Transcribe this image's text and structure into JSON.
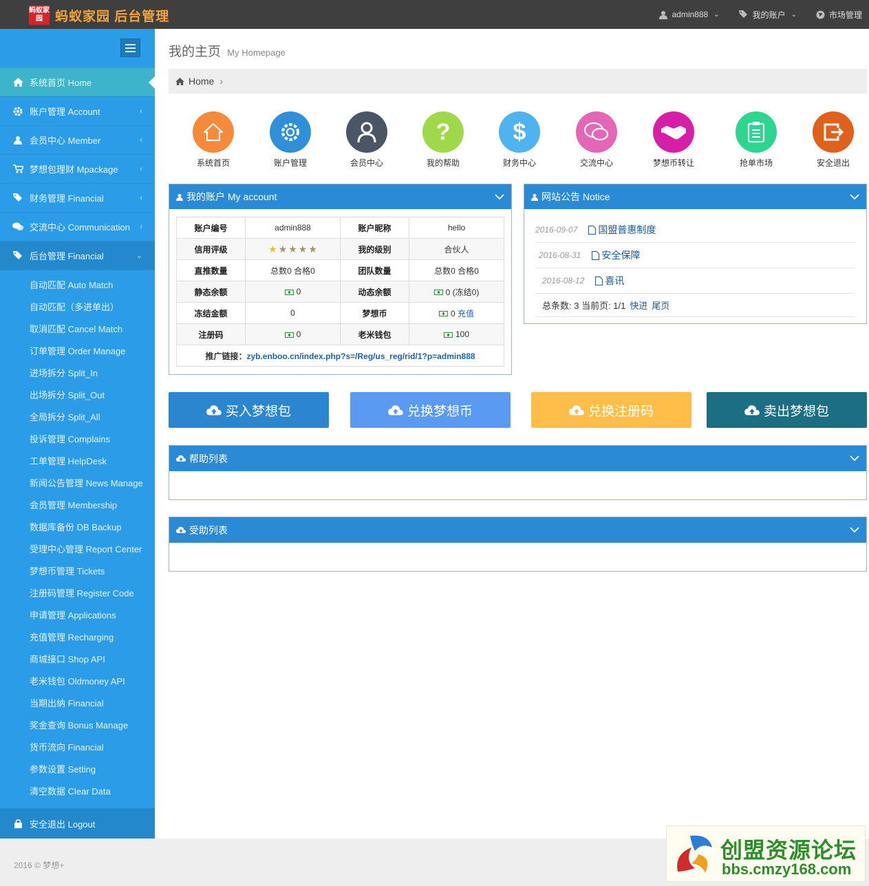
{
  "topbar": {
    "logo_badge": "蚂蚁家园",
    "logo_text": "蚂蚁家园 后台管理",
    "user": "admin888",
    "my_account": "我的账户",
    "market": "市场管理"
  },
  "sidebar": {
    "main_items": [
      {
        "label": "系统首页 Home",
        "icon": "home-icon"
      },
      {
        "label": "账户管理 Account",
        "icon": "gear-icon"
      },
      {
        "label": "会员中心 Member",
        "icon": "user-icon"
      },
      {
        "label": "梦想包理财 Mpackage",
        "icon": "cart-icon"
      },
      {
        "label": "财务管理 Financial",
        "icon": "tags-icon"
      },
      {
        "label": "交流中心 Communication",
        "icon": "comments-icon"
      },
      {
        "label": "后台管理 Financial",
        "icon": "tags-icon"
      }
    ],
    "sub_items": [
      "自动匹配 Auto Match",
      "自动匹配（多进单出）",
      "取消匹配 Cancel Match",
      "订单管理 Order Manage",
      "进场拆分 Split_In",
      "出场拆分 Split_Out",
      "全局拆分 Split_All",
      "投诉管理 Complains",
      "工单管理 HelpDesk",
      "新闻公告管理 News Manage",
      "会员管理 Membership",
      "数据库备份 DB Backup",
      "受理中心管理 Report Center",
      "梦想币管理 Tickets",
      "注册码管理 Register Code",
      "申请管理 Applications",
      "充值管理 Recharging",
      "商城接口 Shop API",
      "老米钱包 Oldmoney API",
      "当期出纳 Financial",
      "奖金查询 Bonus Manage",
      "货币流向 Financial",
      "参数设置 Setting",
      "清空数据 Clear Data"
    ],
    "logout": "安全退出 Logout"
  },
  "page": {
    "title": "我的主页",
    "title_en": "My Homepage",
    "breadcrumb": "Home"
  },
  "shortcuts": [
    {
      "label": "系统首页",
      "color": "#f58a3a",
      "icon": "house-icon"
    },
    {
      "label": "账户管理",
      "color": "#2f8fd8",
      "icon": "gear-icon"
    },
    {
      "label": "会员中心",
      "color": "#4a5566",
      "icon": "user-icon"
    },
    {
      "label": "我的帮助",
      "color": "#9fd94a",
      "icon": "question-icon"
    },
    {
      "label": "财务中心",
      "color": "#4fb3ee",
      "icon": "dollar-icon"
    },
    {
      "label": "交流中心",
      "color": "#e466b6",
      "icon": "chat-icon"
    },
    {
      "label": "梦想币转让",
      "color": "#d61fa6",
      "icon": "handshake-icon"
    },
    {
      "label": "抢单市场",
      "color": "#2dd68e",
      "icon": "clipboard-icon"
    },
    {
      "label": "安全退出",
      "color": "#e0611b",
      "icon": "exit-icon"
    }
  ],
  "account": {
    "title": "我的账户 My account",
    "rows": [
      {
        "k1": "账户编号",
        "v1": "admin888",
        "k2": "账户昵称",
        "v2": "hello"
      },
      {
        "k1": "信用评级",
        "v1": "",
        "k2": "我的级别",
        "v2": "合伙人"
      },
      {
        "k1": "直推数量",
        "v1": "总数0 合格0",
        "k2": "团队数量",
        "v2": "总数0 合格0"
      },
      {
        "k1": "静态余额",
        "v1": "0",
        "k2": "动态余额",
        "v2": "0 (冻结0)"
      },
      {
        "k1": "冻结金额",
        "v1": "0",
        "k2": "梦想币",
        "v2": "0"
      },
      {
        "k1": "注册码",
        "v1": "0",
        "k2": "老米钱包",
        "v2": "100"
      }
    ],
    "stars_total": 5,
    "stars_gold": 1,
    "recharge": "充值",
    "promo_label": "推广链接：",
    "promo_url": "zyb.enboo.cn/index.php?s=/Reg/us_reg/rid/1?p=admin888"
  },
  "notice": {
    "title": "网站公告 Notice",
    "items": [
      {
        "date": "2016-09-07",
        "title": "国盟普惠制度"
      },
      {
        "date": "2016-08-31",
        "title": "安全保障"
      },
      {
        "date": "2016-08-12",
        "title": "喜讯"
      }
    ],
    "footer": "总条数: 3 当前页: 1/1",
    "quick": "快进",
    "last": "尾页"
  },
  "actions": [
    {
      "label": "买入梦想包",
      "color": "#2b85cf"
    },
    {
      "label": "兑换梦想币",
      "color": "#5b9af2"
    },
    {
      "label": "兑换注册码",
      "color": "#ffbd4a"
    },
    {
      "label": "卖出梦想包",
      "color": "#1b6e84"
    }
  ],
  "help_list": {
    "title": "帮助列表"
  },
  "receive_list": {
    "title": "受助列表"
  },
  "footer": {
    "copyright": "2016 © 梦想+"
  },
  "watermark": {
    "line1": "创盟资源论坛",
    "line2": "bbs.cmzy168.com"
  }
}
